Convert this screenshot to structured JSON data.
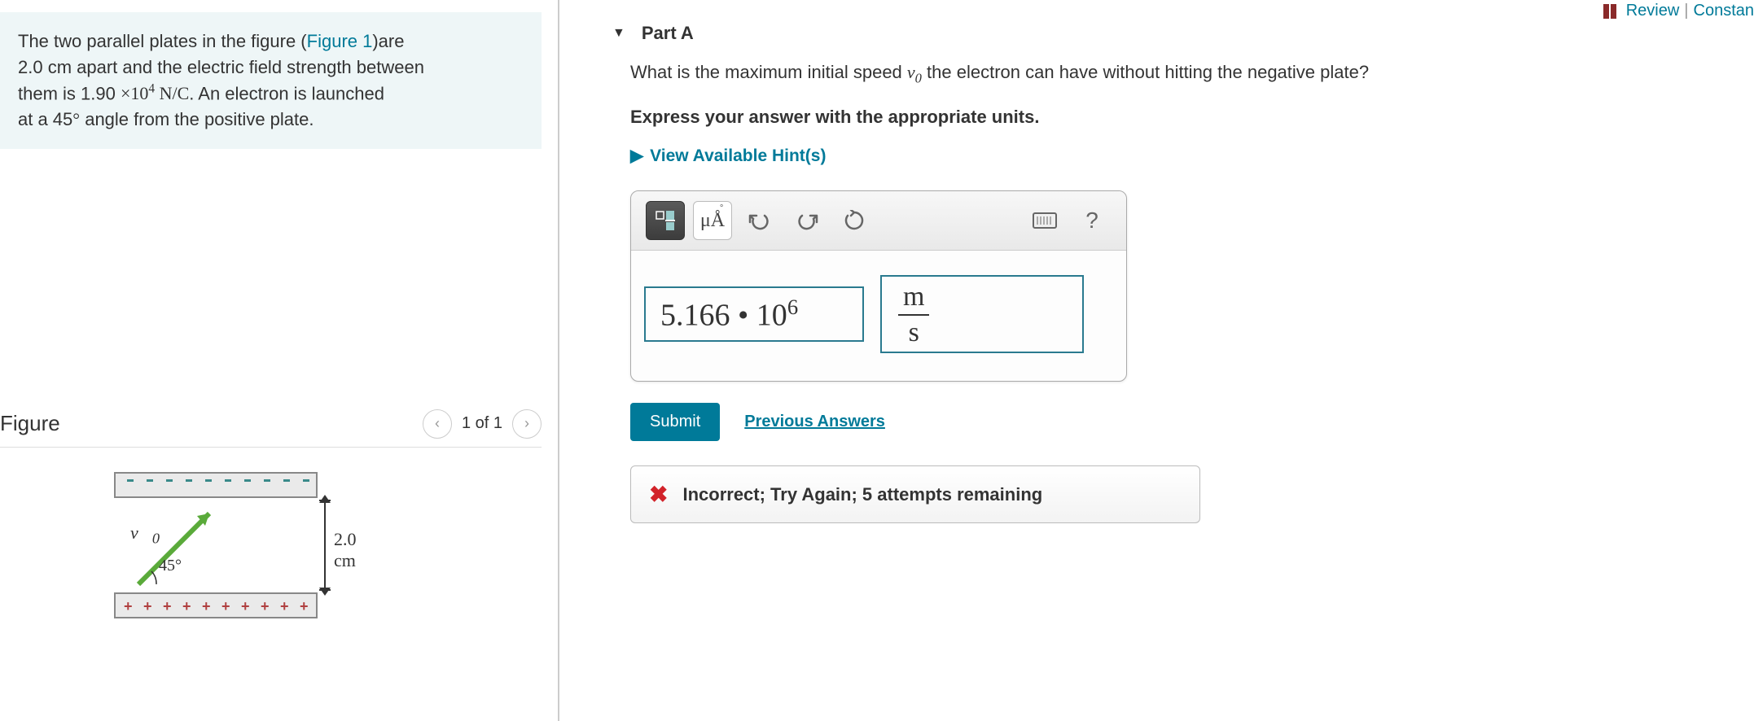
{
  "top_links": {
    "review": "Review",
    "constants": "Constan"
  },
  "problem": {
    "line1a": "The two parallel plates in the figure (",
    "figure_link": "Figure 1",
    "line1b": ")are",
    "line2": "2.0 cm apart and the electric field strength between",
    "line3a": "them is 1.90 ",
    "field_value": "×10",
    "field_exp": "4",
    "field_units": " N/C",
    "line3b": ". An electron is launched",
    "line4a": "at a 45",
    "deg": "°",
    "line4b": " angle from the positive plate."
  },
  "figure": {
    "title": "Figure",
    "pager": "1 of 1",
    "v_label": "v⃗",
    "v_sub": "0",
    "angle": "45°",
    "dim": "2.0 cm"
  },
  "part": {
    "header": "Part A",
    "question_a": "What is the maximum initial speed ",
    "var": "v",
    "var_sub": "0",
    "question_b": " the electron can have without hitting the negative plate?",
    "instruction": "Express your answer with the appropriate units.",
    "hints": "View Available Hint(s)"
  },
  "toolbar": {
    "units_btn": "μÅ",
    "help": "?"
  },
  "answer": {
    "value": "5.166 • 10",
    "exp": "6",
    "unit_num": "m",
    "unit_den": "s"
  },
  "actions": {
    "submit": "Submit",
    "previous": "Previous Answers"
  },
  "feedback": {
    "text": "Incorrect; Try Again; 5 attempts remaining"
  }
}
